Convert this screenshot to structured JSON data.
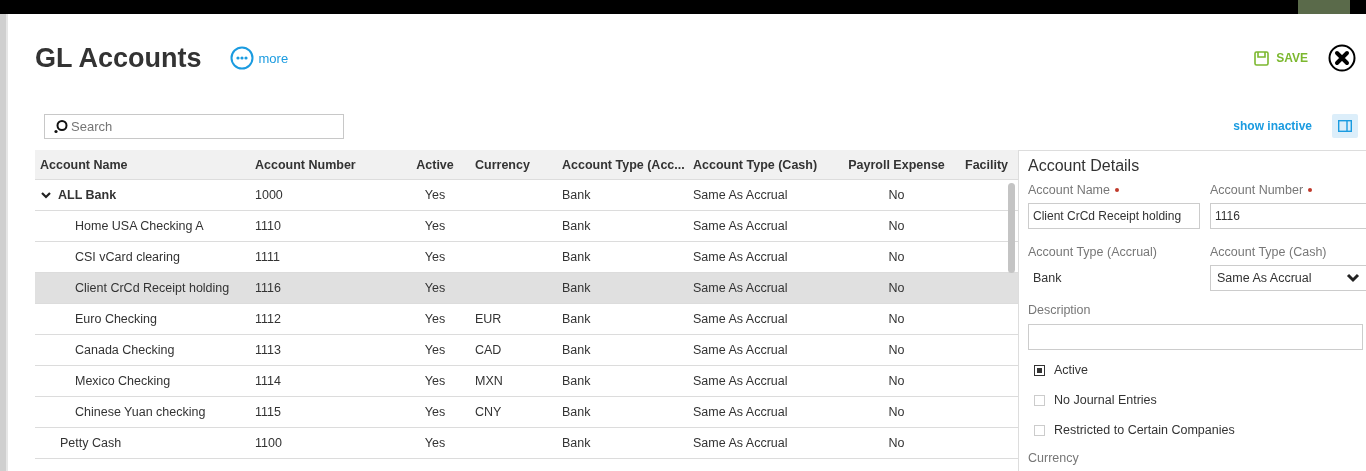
{
  "header": {
    "title": "GL Accounts",
    "more_label": "more",
    "save_label": "SAVE"
  },
  "toolbar": {
    "search": {
      "placeholder": "Search"
    },
    "show_inactive": "show inactive"
  },
  "table": {
    "columns": [
      "Account Name",
      "Account Number",
      "Active",
      "Currency",
      "Account Type (Acc...",
      "Account Type (Cash)",
      "Payroll Expense",
      "Facility"
    ],
    "rows": [
      {
        "name": "ALL Bank",
        "expanded": true,
        "selected": false,
        "number": "1000",
        "active": "Yes",
        "type_accrual": "Bank",
        "type_cash": "Same As Accrual",
        "payroll": "No",
        "children": [
          {
            "name": "Home USA Checking A",
            "selected": false,
            "number": "1110",
            "active": "Yes",
            "type_accrual": "Bank",
            "type_cash": "Same As Accrual",
            "payroll": "No"
          },
          {
            "name": "CSI vCard clearing",
            "selected": false,
            "number": "1111",
            "active": "Yes",
            "type_accrual": "Bank",
            "type_cash": "Same As Accrual",
            "payroll": "No"
          },
          {
            "name": "Client CrCd Receipt holding",
            "selected": true,
            "number": "1116",
            "active": "Yes",
            "type_accrual": "Bank",
            "type_cash": "Same As Accrual",
            "payroll": "No"
          },
          {
            "name": "Euro Checking",
            "selected": false,
            "number": "1112",
            "active": "Yes",
            "currency": "EUR",
            "type_accrual": "Bank",
            "type_cash": "Same As Accrual",
            "payroll": "No"
          },
          {
            "name": "Canada Checking",
            "selected": false,
            "number": "1113",
            "active": "Yes",
            "currency": "CAD",
            "type_accrual": "Bank",
            "type_cash": "Same As Accrual",
            "payroll": "No"
          },
          {
            "name": "Mexico Checking",
            "selected": false,
            "number": "1114",
            "active": "Yes",
            "currency": "MXN",
            "type_accrual": "Bank",
            "type_cash": "Same As Accrual",
            "payroll": "No"
          },
          {
            "name": "Chinese Yuan checking",
            "selected": false,
            "number": "1115",
            "active": "Yes",
            "currency": "CNY",
            "type_accrual": "Bank",
            "type_cash": "Same As Accrual",
            "payroll": "No"
          }
        ]
      },
      {
        "name": "Petty Cash",
        "selected": false,
        "number": "1100",
        "active": "Yes",
        "type_accrual": "Bank",
        "type_cash": "Same As Accrual",
        "payroll": "No"
      }
    ]
  },
  "details": {
    "title": "Account Details",
    "account_name": {
      "label": "Account Name",
      "required": true,
      "value": "Client CrCd Receipt holding"
    },
    "account_number": {
      "label": "Account Number",
      "required": true,
      "value": "1116"
    },
    "type_accrual": {
      "label": "Account Type (Accrual)",
      "value": "Bank"
    },
    "type_cash": {
      "label": "Account Type (Cash)",
      "value": "Same As Accrual"
    },
    "description": {
      "label": "Description"
    },
    "checkboxes": [
      {
        "label": "Active",
        "checked": true
      },
      {
        "label": "No Journal Entries",
        "checked": false
      },
      {
        "label": "Restricted to Certain Companies",
        "checked": false
      }
    ],
    "currency_label": "Currency"
  }
}
